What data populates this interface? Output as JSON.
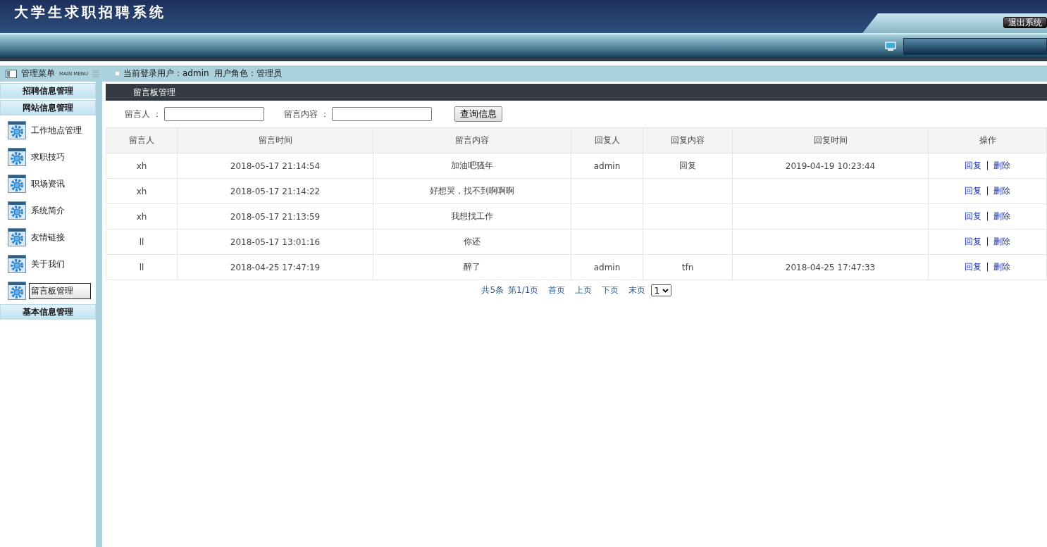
{
  "header": {
    "title": "大学生求职招聘系统",
    "logout": "退出系统"
  },
  "menu_bar": {
    "title": "管理菜单",
    "subtitle": "MAIN MENU",
    "user_info": "当前登录用户：admin  用户角色：管理员"
  },
  "sidebar": {
    "groups": [
      {
        "label": "招聘信息管理"
      },
      {
        "label": "网站信息管理",
        "children": [
          {
            "label": "工作地点管理",
            "selected": false
          },
          {
            "label": "求职技巧",
            "selected": false
          },
          {
            "label": "职场资讯",
            "selected": false
          },
          {
            "label": "系统简介",
            "selected": false
          },
          {
            "label": "友情链接",
            "selected": false
          },
          {
            "label": "关于我们",
            "selected": false
          },
          {
            "label": "留言板管理",
            "selected": true
          }
        ]
      },
      {
        "label": "基本信息管理"
      }
    ]
  },
  "panel": {
    "title": "留言板管理"
  },
  "search": {
    "fields": [
      {
        "label": "留言人 ："
      },
      {
        "label": "留言内容 ："
      }
    ],
    "button": "查询信息"
  },
  "table": {
    "columns": [
      "留言人",
      "留言时间",
      "留言内容",
      "回复人",
      "回复内容",
      "回复时间",
      "操作"
    ],
    "rows": [
      {
        "cells": [
          "xh",
          "2018-05-17 21:14:54",
          "加油吧骚年",
          "admin",
          "回复",
          "2019-04-19 10:23:44"
        ],
        "actions": [
          "回复",
          "删除"
        ],
        "separator": "|"
      },
      {
        "cells": [
          "xh",
          "2018-05-17 21:14:22",
          "好想哭，找不到啊啊啊",
          "",
          "",
          ""
        ],
        "actions": [
          "回复",
          "删除"
        ],
        "separator": "|"
      },
      {
        "cells": [
          "xh",
          "2018-05-17 21:13:59",
          "我想找工作",
          "",
          "",
          ""
        ],
        "actions": [
          "回复",
          "删除"
        ],
        "separator": "|"
      },
      {
        "cells": [
          "ll",
          "2018-05-17 13:01:16",
          "你还",
          "",
          "",
          ""
        ],
        "actions": [
          "回复",
          "删除"
        ],
        "separator": "|"
      },
      {
        "cells": [
          "ll",
          "2018-04-25 17:47:19",
          "醉了",
          "admin",
          "tfn",
          "2018-04-25 17:47:33"
        ],
        "actions": [
          "回复",
          "删除"
        ],
        "separator": "|"
      }
    ]
  },
  "pagination": {
    "total": "共5条",
    "page": "第1/1页",
    "links": [
      "首页",
      "上页",
      "下页",
      "末页"
    ],
    "page_select": "1"
  }
}
